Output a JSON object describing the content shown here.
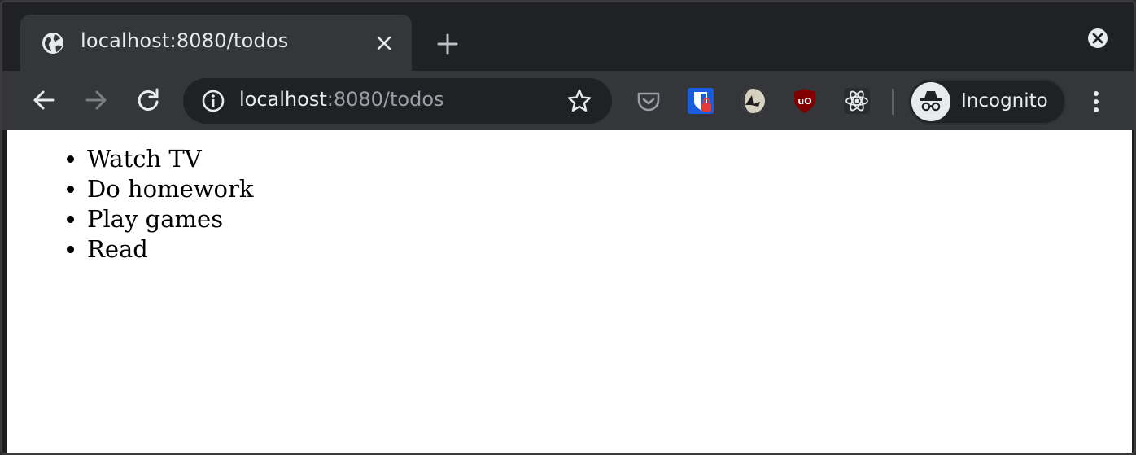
{
  "browser": {
    "tab": {
      "title": "localhost:8080/todos",
      "favicon": "globe-icon"
    },
    "address_bar": {
      "host": "localhost",
      "path": ":8080/todos",
      "info_icon": "info-icon",
      "bookmark_icon": "star-icon"
    },
    "extensions": [
      {
        "name": "pocket-icon"
      },
      {
        "name": "bitwarden-icon"
      },
      {
        "name": "dark-reader-icon"
      },
      {
        "name": "ublock-origin-icon"
      },
      {
        "name": "react-devtools-icon"
      }
    ],
    "profile": {
      "label": "Incognito",
      "icon": "incognito-icon"
    },
    "colors": {
      "frame": "#202124",
      "toolbar": "#35363a",
      "text": "#e8eaed",
      "muted_text": "#9aa0a6"
    }
  },
  "page": {
    "todos": [
      "Watch TV",
      "Do homework",
      "Play games",
      "Read"
    ]
  }
}
